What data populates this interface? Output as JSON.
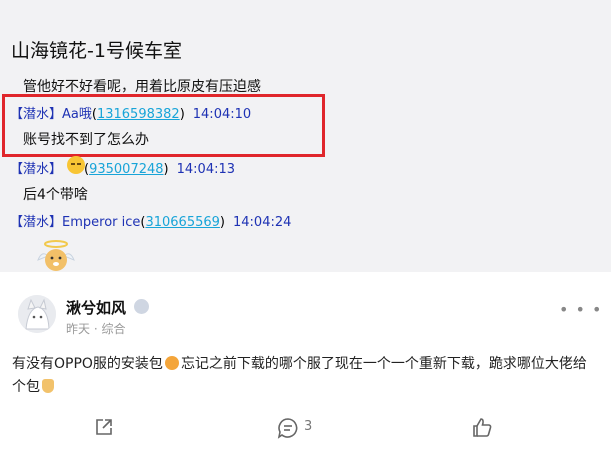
{
  "chat": {
    "title": "山海镜花-1号候车室",
    "messages": [
      {
        "text": "管他好不好看呢，用着比原皮有压迫感"
      },
      {
        "tag": "【潜水】",
        "nick": "Aa哦",
        "qq": "1316598382",
        "time": "14:04:10",
        "text": "账号找不到了怎么办"
      },
      {
        "tag": "【潜水】",
        "nick": "",
        "qq": "935007248",
        "time": "14:04:13",
        "text": "后4个带啥"
      },
      {
        "tag": "【潜水】",
        "nick": "Emperor ice",
        "qq": "310665569",
        "time": "14:04:24",
        "text": ""
      }
    ]
  },
  "post": {
    "username": "湫兮如风",
    "meta": "昨天 · 综合",
    "body_part1": "有没有OPPO服的安装包",
    "body_part2": "忘记之前下载的哪个服了现在一个一个重新下载，跪求哪位大佬给个包",
    "comment_count": "3"
  },
  "icons": {
    "more": "more-dots-icon",
    "share": "share-icon",
    "comment": "comment-icon",
    "like": "thumbs-up-icon"
  },
  "colors": {
    "highlight": "#e0262b",
    "link": "#18a4d8",
    "name": "#1e32b4"
  }
}
